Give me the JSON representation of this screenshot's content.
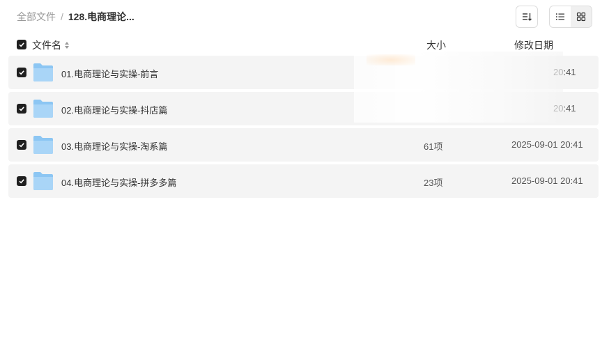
{
  "breadcrumb": {
    "root": "全部文件",
    "separator": "/",
    "current": "128.电商理论..."
  },
  "toolbar": {
    "sort_icon": "sort-icon",
    "list_view_icon": "list-view-icon",
    "grid_view_icon": "grid-view-icon",
    "active_view": "list"
  },
  "table": {
    "headers": {
      "name": "文件名",
      "size": "大小",
      "date": "修改日期"
    },
    "rows": [
      {
        "name": "01.电商理论与实操-前言",
        "size": "",
        "date": "20:41",
        "checked": true
      },
      {
        "name": "02.电商理论与实操-抖店篇",
        "size": "",
        "date": "20:41",
        "checked": true
      },
      {
        "name": "03.电商理论与实操-淘系篇",
        "size": "61项",
        "date": "2025-09-01 20:41",
        "checked": true
      },
      {
        "name": "04.电商理论与实操-拼多多篇",
        "size": "23项",
        "date": "2025-09-01 20:41",
        "checked": true
      }
    ]
  },
  "colors": {
    "checkbox": "#1f1f1f",
    "row_bg": "#f4f4f4",
    "folder": "#7dbcf0"
  }
}
